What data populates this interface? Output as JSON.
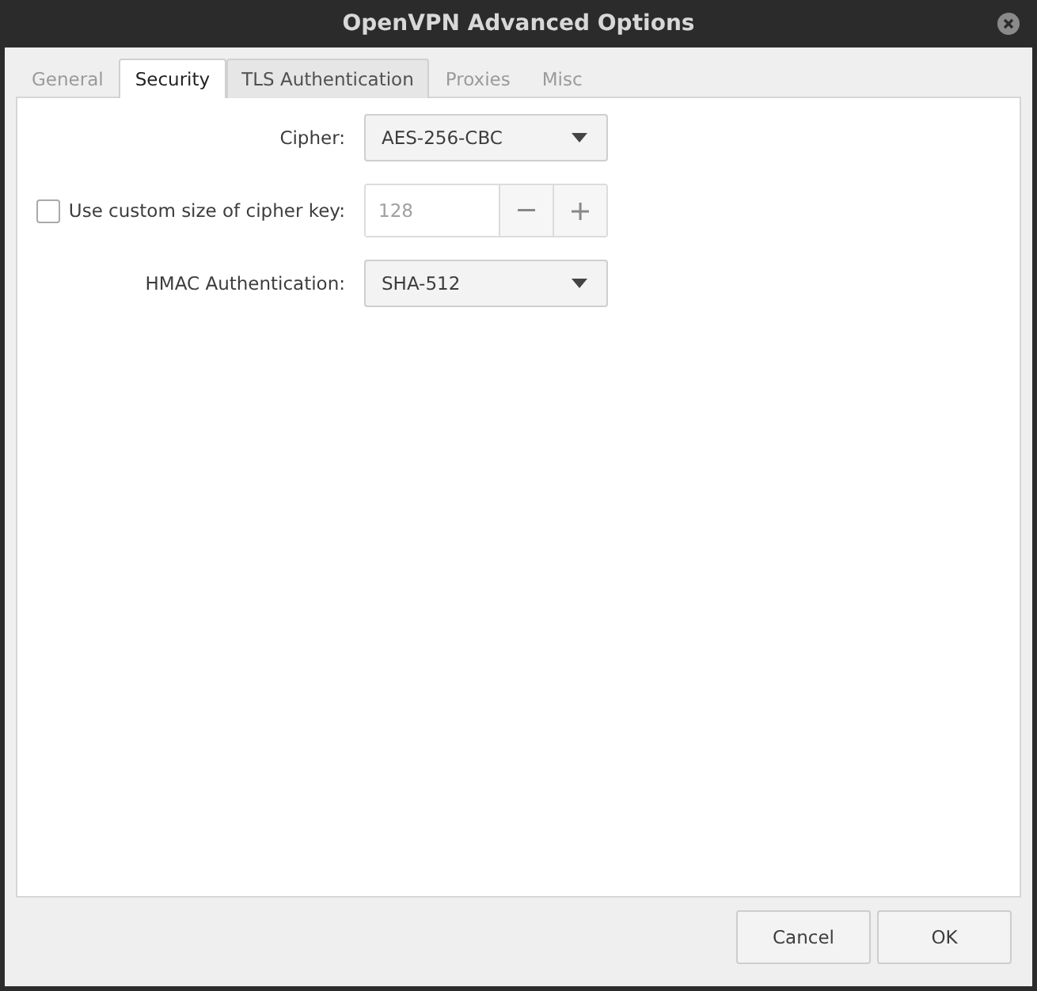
{
  "window": {
    "title": "OpenVPN Advanced Options"
  },
  "tabs": [
    {
      "label": "General",
      "selected": false,
      "disabled": true
    },
    {
      "label": "Security",
      "selected": true,
      "disabled": false
    },
    {
      "label": "TLS Authentication",
      "selected": false,
      "disabled": false
    },
    {
      "label": "Proxies",
      "selected": false,
      "disabled": true
    },
    {
      "label": "Misc",
      "selected": false,
      "disabled": true
    }
  ],
  "security": {
    "cipher": {
      "label": "Cipher:",
      "value": "AES-256-CBC"
    },
    "custom_key_size": {
      "label": "Use custom size of cipher key:",
      "checked": false,
      "value": "128",
      "disabled": true
    },
    "hmac": {
      "label": "HMAC Authentication:",
      "value": "SHA-512"
    }
  },
  "buttons": [
    "Cancel",
    "OK"
  ]
}
